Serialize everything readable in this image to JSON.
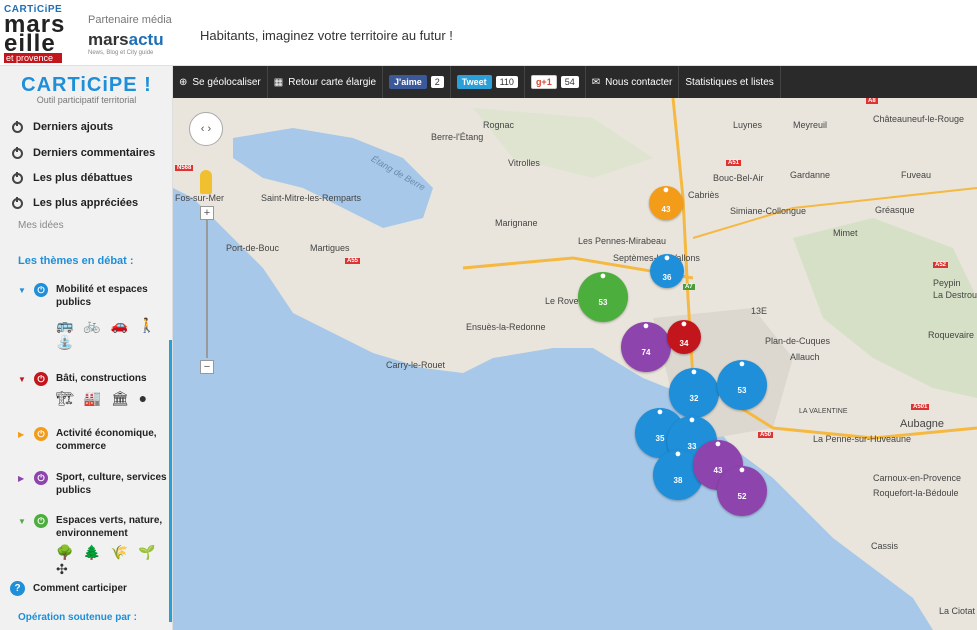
{
  "header": {
    "logo_top": "CARTiCiPE",
    "logo_main": "mars eille",
    "logo_region": "et provence",
    "partner_label": "Partenaire média",
    "partner_name_1": "mars",
    "partner_name_2": "actu",
    "partner_sub": "News, Blog et City guide",
    "tagline": "Habitants, imaginez votre territoire au futur !"
  },
  "toolbar": {
    "geolocate": "Se géolocaliser",
    "back_map": "Retour carte élargie",
    "facebook": "J'aime",
    "facebook_count": "2",
    "tweet": "Tweet",
    "tweet_count": "110",
    "gplus": "g+1",
    "gplus_count": "54",
    "contact": "Nous contacter",
    "stats": "Statistiques et listes"
  },
  "sidebar": {
    "brand": "CARTiCiPE !",
    "brand_sub": "Outil participatif territorial",
    "nav": [
      "Derniers ajouts",
      "Derniers commentaires",
      "Les plus débattues",
      "Les plus appréciées"
    ],
    "mes_idees": "Mes idées",
    "themes_title": "Les thèmes en débat :",
    "themes": [
      {
        "label": "Mobilité et espaces publics",
        "color": "#1e8fd8",
        "icons": "🚌 🚲 🚗 🚶 ⛲"
      },
      {
        "label": "Bâti, constructions",
        "color": "#c3161c",
        "icons": "🏗 🏭 🏛 ●"
      },
      {
        "label": "Activité économique, commerce",
        "color": "#f39c1a",
        "icons": ""
      },
      {
        "label": "Sport, culture, services publics",
        "color": "#8e44ad",
        "icons": ""
      },
      {
        "label": "Espaces verts, nature, environnement",
        "color": "#4cae3c",
        "icons": "🌳 🌲 🌾 🌱 ✣"
      }
    ],
    "comment": "Comment carticiper",
    "operation": "Opération soutenue par :"
  },
  "map": {
    "labels": [
      "Rognac",
      "Luynes",
      "Meyreuil",
      "Châteauneuf-le-Rouge",
      "Berre-l'Étang",
      "Étang de Berre",
      "Vitrolles",
      "Bouc-Bel-Air",
      "Gardanne",
      "Fuveau",
      "Cabriès",
      "Saint-Mitre-les-Remparts",
      "Fos-sur-Mer",
      "Simiane-Collongue",
      "Gréasque",
      "Marignane",
      "Mimet",
      "Les Pennes-Mirabeau",
      "Port-de-Bouc",
      "Martigues",
      "Septèmes-les-Vallons",
      "Peypin",
      "La Destrous",
      "Le Rove",
      "13E",
      "Ensuès-la-Redonne",
      "Plan-de-Cuques",
      "Roquevaire",
      "Allauch",
      "Carry-le-Rouet",
      "LA VALENTINE",
      "Aubagne",
      "La Penne-sur-Huveaune",
      "Carnoux-en-Provence",
      "Roquefort-la-Bédoule",
      "Cassis",
      "La Ciotat"
    ],
    "roads": [
      "A8",
      "N568",
      "A55",
      "A51",
      "A7",
      "A52",
      "A501",
      "A50"
    ],
    "pins": [
      {
        "n": "43",
        "color": "#f39c1a"
      },
      {
        "n": "36",
        "color": "#1e8fd8"
      },
      {
        "n": "53",
        "color": "#4cae3c"
      },
      {
        "n": "74",
        "color": "#8e44ad"
      },
      {
        "n": "34",
        "color": "#c3161c"
      },
      {
        "n": "32",
        "color": "#1e8fd8"
      },
      {
        "n": "53",
        "color": "#1e8fd8"
      },
      {
        "n": "35",
        "color": "#1e8fd8"
      },
      {
        "n": "33",
        "color": "#1e8fd8"
      },
      {
        "n": "38",
        "color": "#1e8fd8"
      },
      {
        "n": "43",
        "color": "#8e44ad"
      },
      {
        "n": "52",
        "color": "#8e44ad"
      }
    ]
  }
}
